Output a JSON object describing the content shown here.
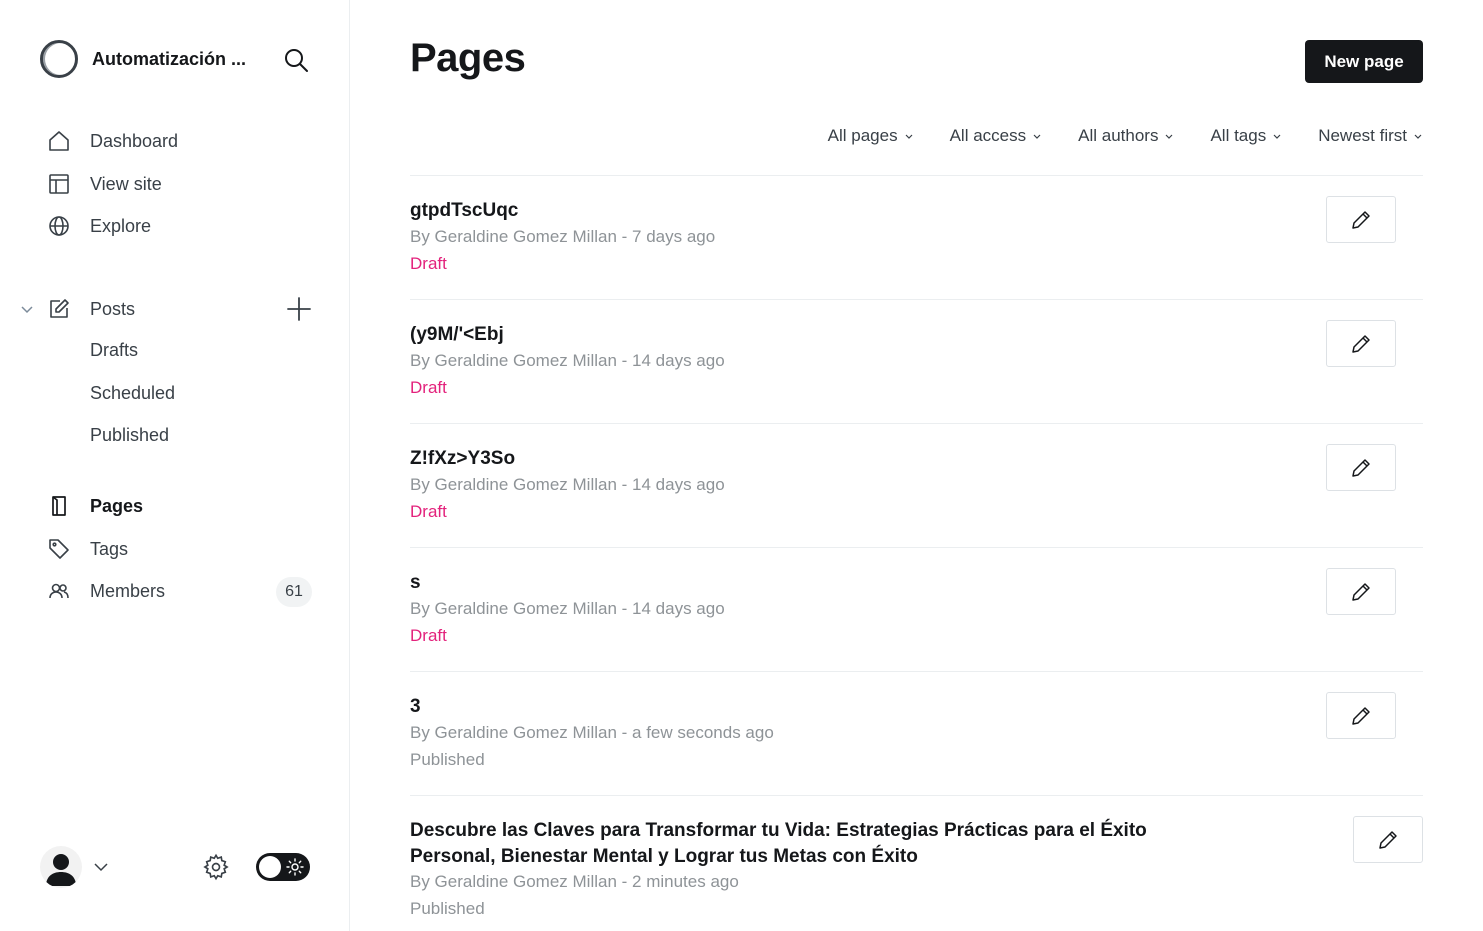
{
  "sidebar": {
    "site_name": "Automatización ...",
    "nav": [
      {
        "label": "Dashboard",
        "icon": "home-icon"
      },
      {
        "label": "View site",
        "icon": "layout-icon"
      },
      {
        "label": "Explore",
        "icon": "globe-icon"
      }
    ],
    "posts": {
      "label": "Posts",
      "sub": [
        "Drafts",
        "Scheduled",
        "Published"
      ]
    },
    "pages_label": "Pages",
    "tags_label": "Tags",
    "members_label": "Members",
    "members_count": "61"
  },
  "header": {
    "title": "Pages",
    "new_button": "New page"
  },
  "filters": [
    "All pages",
    "All access",
    "All authors",
    "All tags",
    "Newest first"
  ],
  "pages": [
    {
      "title": "gtpdTscUqc",
      "meta": "By Geraldine Gomez Millan - 7 days ago",
      "status": "Draft"
    },
    {
      "title": "(y9M/'<Ebj",
      "meta": "By Geraldine Gomez Millan - 14 days ago",
      "status": "Draft"
    },
    {
      "title": "Z!fXz>Y3So",
      "meta": "By Geraldine Gomez Millan - 14 days ago",
      "status": "Draft"
    },
    {
      "title": "s",
      "meta": "By Geraldine Gomez Millan - 14 days ago",
      "status": "Draft"
    },
    {
      "title": "3",
      "meta": "By Geraldine Gomez Millan - a few seconds ago",
      "status": "Published"
    },
    {
      "title": "Descubre las Claves para Transformar tu Vida: Estrategias Prácticas para el Éxito Personal, Bienestar Mental y Lograr tus Metas con Éxito",
      "meta": "By Geraldine Gomez Millan - 2 minutes ago",
      "status": "Published"
    }
  ],
  "colors": {
    "draft": "#e3227c",
    "primary_button": "#15171a",
    "muted_text": "#8e9397"
  }
}
